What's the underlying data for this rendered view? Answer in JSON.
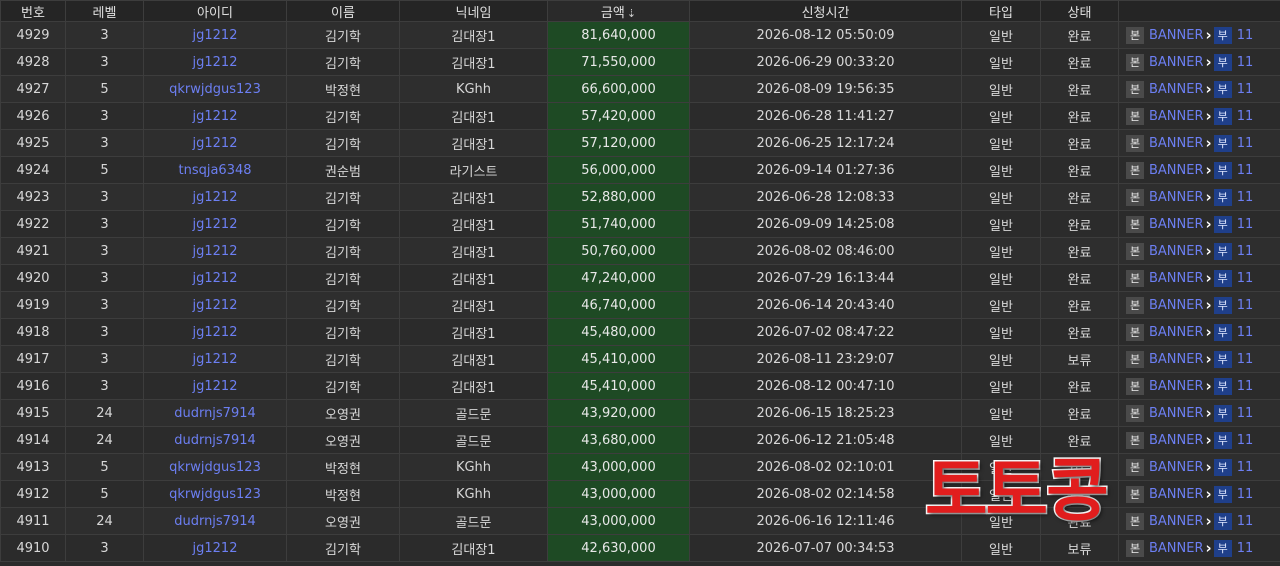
{
  "headers": {
    "number": "번호",
    "level": "레벨",
    "user_id": "아이디",
    "name": "이름",
    "nickname": "닉네임",
    "amount": "금액",
    "request_time": "신청시간",
    "type": "타입",
    "status": "상태"
  },
  "sort_icon": "sort-descending-icon",
  "action_labels": {
    "bon": "본",
    "banner": "BANNER",
    "bu": "부",
    "count": "11"
  },
  "colors": {
    "amount_bg": "#1e4a24",
    "link": "#6c7ff2",
    "watermark": "#e11d1d"
  },
  "watermark": "토토콩",
  "rows": [
    {
      "no": "4929",
      "level": "3",
      "user_id": "jg1212",
      "name": "김기학",
      "nickname": "김대장1",
      "amount": "81,640,000",
      "time": "2026-08-12 05:50:09",
      "type": "일반",
      "status": "완료"
    },
    {
      "no": "4928",
      "level": "3",
      "user_id": "jg1212",
      "name": "김기학",
      "nickname": "김대장1",
      "amount": "71,550,000",
      "time": "2026-06-29 00:33:20",
      "type": "일반",
      "status": "완료"
    },
    {
      "no": "4927",
      "level": "5",
      "user_id": "qkrwjdgus123",
      "name": "박정현",
      "nickname": "KGhh",
      "amount": "66,600,000",
      "time": "2026-08-09 19:56:35",
      "type": "일반",
      "status": "완료"
    },
    {
      "no": "4926",
      "level": "3",
      "user_id": "jg1212",
      "name": "김기학",
      "nickname": "김대장1",
      "amount": "57,420,000",
      "time": "2026-06-28 11:41:27",
      "type": "일반",
      "status": "완료"
    },
    {
      "no": "4925",
      "level": "3",
      "user_id": "jg1212",
      "name": "김기학",
      "nickname": "김대장1",
      "amount": "57,120,000",
      "time": "2026-06-25 12:17:24",
      "type": "일반",
      "status": "완료"
    },
    {
      "no": "4924",
      "level": "5",
      "user_id": "tnsqja6348",
      "name": "권순범",
      "nickname": "라기스트",
      "amount": "56,000,000",
      "time": "2026-09-14 01:27:36",
      "type": "일반",
      "status": "완료"
    },
    {
      "no": "4923",
      "level": "3",
      "user_id": "jg1212",
      "name": "김기학",
      "nickname": "김대장1",
      "amount": "52,880,000",
      "time": "2026-06-28 12:08:33",
      "type": "일반",
      "status": "완료"
    },
    {
      "no": "4922",
      "level": "3",
      "user_id": "jg1212",
      "name": "김기학",
      "nickname": "김대장1",
      "amount": "51,740,000",
      "time": "2026-09-09 14:25:08",
      "type": "일반",
      "status": "완료"
    },
    {
      "no": "4921",
      "level": "3",
      "user_id": "jg1212",
      "name": "김기학",
      "nickname": "김대장1",
      "amount": "50,760,000",
      "time": "2026-08-02 08:46:00",
      "type": "일반",
      "status": "완료"
    },
    {
      "no": "4920",
      "level": "3",
      "user_id": "jg1212",
      "name": "김기학",
      "nickname": "김대장1",
      "amount": "47,240,000",
      "time": "2026-07-29 16:13:44",
      "type": "일반",
      "status": "완료"
    },
    {
      "no": "4919",
      "level": "3",
      "user_id": "jg1212",
      "name": "김기학",
      "nickname": "김대장1",
      "amount": "46,740,000",
      "time": "2026-06-14 20:43:40",
      "type": "일반",
      "status": "완료"
    },
    {
      "no": "4918",
      "level": "3",
      "user_id": "jg1212",
      "name": "김기학",
      "nickname": "김대장1",
      "amount": "45,480,000",
      "time": "2026-07-02 08:47:22",
      "type": "일반",
      "status": "완료"
    },
    {
      "no": "4917",
      "level": "3",
      "user_id": "jg1212",
      "name": "김기학",
      "nickname": "김대장1",
      "amount": "45,410,000",
      "time": "2026-08-11 23:29:07",
      "type": "일반",
      "status": "보류"
    },
    {
      "no": "4916",
      "level": "3",
      "user_id": "jg1212",
      "name": "김기학",
      "nickname": "김대장1",
      "amount": "45,410,000",
      "time": "2026-08-12 00:47:10",
      "type": "일반",
      "status": "완료"
    },
    {
      "no": "4915",
      "level": "24",
      "user_id": "dudrnjs7914",
      "name": "오영권",
      "nickname": "골드문",
      "amount": "43,920,000",
      "time": "2026-06-15 18:25:23",
      "type": "일반",
      "status": "완료"
    },
    {
      "no": "4914",
      "level": "24",
      "user_id": "dudrnjs7914",
      "name": "오영권",
      "nickname": "골드문",
      "amount": "43,680,000",
      "time": "2026-06-12 21:05:48",
      "type": "일반",
      "status": "완료"
    },
    {
      "no": "4913",
      "level": "5",
      "user_id": "qkrwjdgus123",
      "name": "박정현",
      "nickname": "KGhh",
      "amount": "43,000,000",
      "time": "2026-08-02 02:10:01",
      "type": "일반",
      "status": "완료"
    },
    {
      "no": "4912",
      "level": "5",
      "user_id": "qkrwjdgus123",
      "name": "박정현",
      "nickname": "KGhh",
      "amount": "43,000,000",
      "time": "2026-08-02 02:14:58",
      "type": "일반",
      "status": "완료"
    },
    {
      "no": "4911",
      "level": "24",
      "user_id": "dudrnjs7914",
      "name": "오영권",
      "nickname": "골드문",
      "amount": "43,000,000",
      "time": "2026-06-16 12:11:46",
      "type": "일반",
      "status": "완료"
    },
    {
      "no": "4910",
      "level": "3",
      "user_id": "jg1212",
      "name": "김기학",
      "nickname": "김대장1",
      "amount": "42,630,000",
      "time": "2026-07-07 00:34:53",
      "type": "일반",
      "status": "보류"
    }
  ]
}
